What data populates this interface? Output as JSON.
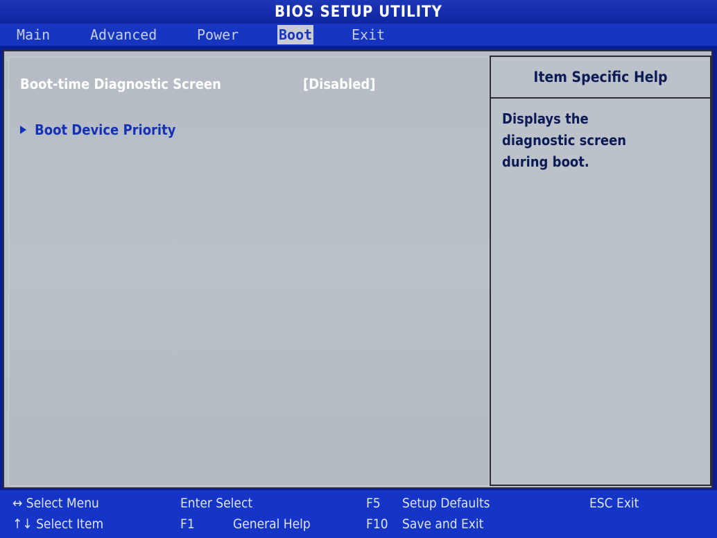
{
  "title": "BIOS SETUP UTILITY",
  "menu": [
    {
      "label": "Main"
    },
    {
      "label": "Advanced"
    },
    {
      "label": "Power"
    },
    {
      "label": "Boot",
      "active": true
    },
    {
      "label": "Exit"
    }
  ],
  "settings": {
    "boot_diag_label": "Boot-time Diagnostic Screen",
    "boot_diag_value": "[Disabled]",
    "boot_device_priority": "Boot Device Priority"
  },
  "help": {
    "header": "Item Specific Help",
    "lines": [
      "Displays the",
      "diagnostic screen",
      "during boot."
    ]
  },
  "footer": {
    "select_menu": "↔ Select Menu",
    "select_item": "↑↓ Select Item",
    "enter_select": "Enter Select",
    "f1_key": "F1",
    "f1_label": "General Help",
    "f5_key": "F5",
    "f5_label": "Setup Defaults",
    "f10_key": "F10",
    "f10_label": "Save and Exit",
    "esc_exit": "ESC Exit"
  },
  "colors": {
    "frame_blue": "#1636c2",
    "panel_gray": "#b8bfc8",
    "highlight_text": "#1632b4"
  }
}
